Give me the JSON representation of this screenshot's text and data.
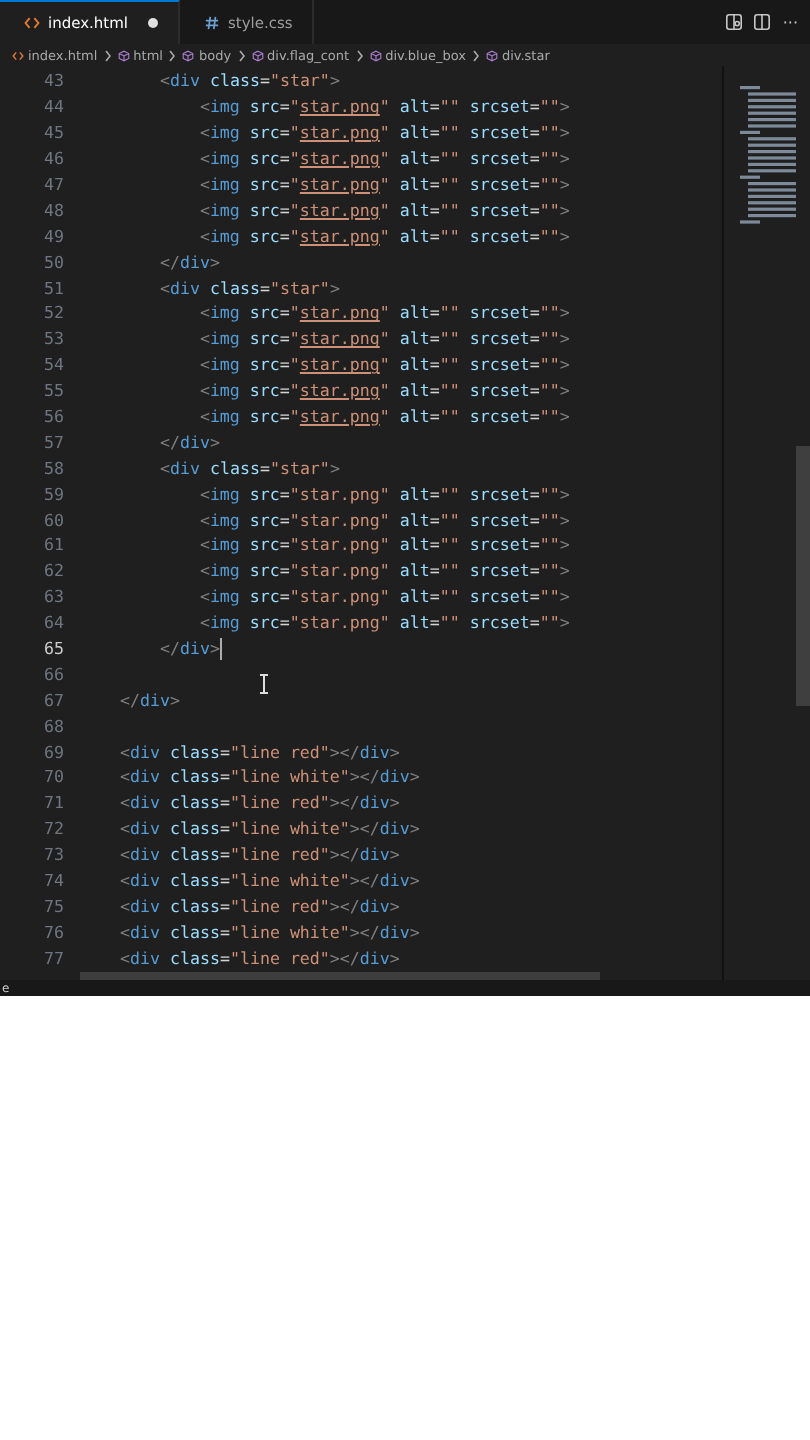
{
  "tabs": [
    {
      "label": "index.html",
      "kind": "html",
      "selected": true,
      "modified": true
    },
    {
      "label": "style.css",
      "kind": "css",
      "selected": false,
      "modified": false
    }
  ],
  "more_actions": "···",
  "breadcrumbs": [
    {
      "label": "index.html",
      "kind": "file"
    },
    {
      "label": "html",
      "kind": "element"
    },
    {
      "label": "body",
      "kind": "element"
    },
    {
      "label": "div.flag_cont",
      "kind": "element"
    },
    {
      "label": "div.blue_box",
      "kind": "element"
    },
    {
      "label": "div.star",
      "kind": "element"
    }
  ],
  "lines": [
    {
      "number": "43",
      "current": false,
      "code": [
        {
          "kind": "punct",
          "text": "        <"
        },
        {
          "kind": "tag",
          "text": "div"
        },
        {
          "kind": "attr",
          "text": " class"
        },
        {
          "kind": "op",
          "text": "="
        },
        {
          "kind": "str",
          "text": "\"star\""
        },
        {
          "kind": "punct",
          "text": ">"
        }
      ]
    },
    {
      "number": "44",
      "current": false,
      "code": [
        {
          "kind": "punct",
          "text": "            <"
        },
        {
          "kind": "tag",
          "text": "img"
        },
        {
          "kind": "attr",
          "text": " src"
        },
        {
          "kind": "op",
          "text": "="
        },
        {
          "kind": "str",
          "text": "\""
        },
        {
          "kind": "link",
          "text": "star.png"
        },
        {
          "kind": "str",
          "text": "\""
        },
        {
          "kind": "attr",
          "text": " alt"
        },
        {
          "kind": "op",
          "text": "="
        },
        {
          "kind": "str",
          "text": "\"\""
        },
        {
          "kind": "attr",
          "text": " srcset"
        },
        {
          "kind": "op",
          "text": "="
        },
        {
          "kind": "str",
          "text": "\"\""
        },
        {
          "kind": "punct",
          "text": ">"
        }
      ]
    },
    {
      "number": "45",
      "current": false,
      "code": [
        {
          "kind": "punct",
          "text": "            <"
        },
        {
          "kind": "tag",
          "text": "img"
        },
        {
          "kind": "attr",
          "text": " src"
        },
        {
          "kind": "op",
          "text": "="
        },
        {
          "kind": "str",
          "text": "\""
        },
        {
          "kind": "link",
          "text": "star.png"
        },
        {
          "kind": "str",
          "text": "\""
        },
        {
          "kind": "attr",
          "text": " alt"
        },
        {
          "kind": "op",
          "text": "="
        },
        {
          "kind": "str",
          "text": "\"\""
        },
        {
          "kind": "attr",
          "text": " srcset"
        },
        {
          "kind": "op",
          "text": "="
        },
        {
          "kind": "str",
          "text": "\"\""
        },
        {
          "kind": "punct",
          "text": ">"
        }
      ]
    },
    {
      "number": "46",
      "current": false,
      "code": [
        {
          "kind": "punct",
          "text": "            <"
        },
        {
          "kind": "tag",
          "text": "img"
        },
        {
          "kind": "attr",
          "text": " src"
        },
        {
          "kind": "op",
          "text": "="
        },
        {
          "kind": "str",
          "text": "\""
        },
        {
          "kind": "link",
          "text": "star.png"
        },
        {
          "kind": "str",
          "text": "\""
        },
        {
          "kind": "attr",
          "text": " alt"
        },
        {
          "kind": "op",
          "text": "="
        },
        {
          "kind": "str",
          "text": "\"\""
        },
        {
          "kind": "attr",
          "text": " srcset"
        },
        {
          "kind": "op",
          "text": "="
        },
        {
          "kind": "str",
          "text": "\"\""
        },
        {
          "kind": "punct",
          "text": ">"
        }
      ]
    },
    {
      "number": "47",
      "current": false,
      "code": [
        {
          "kind": "punct",
          "text": "            <"
        },
        {
          "kind": "tag",
          "text": "img"
        },
        {
          "kind": "attr",
          "text": " src"
        },
        {
          "kind": "op",
          "text": "="
        },
        {
          "kind": "str",
          "text": "\""
        },
        {
          "kind": "link",
          "text": "star.png"
        },
        {
          "kind": "str",
          "text": "\""
        },
        {
          "kind": "attr",
          "text": " alt"
        },
        {
          "kind": "op",
          "text": "="
        },
        {
          "kind": "str",
          "text": "\"\""
        },
        {
          "kind": "attr",
          "text": " srcset"
        },
        {
          "kind": "op",
          "text": "="
        },
        {
          "kind": "str",
          "text": "\"\""
        },
        {
          "kind": "punct",
          "text": ">"
        }
      ]
    },
    {
      "number": "48",
      "current": false,
      "code": [
        {
          "kind": "punct",
          "text": "            <"
        },
        {
          "kind": "tag",
          "text": "img"
        },
        {
          "kind": "attr",
          "text": " src"
        },
        {
          "kind": "op",
          "text": "="
        },
        {
          "kind": "str",
          "text": "\""
        },
        {
          "kind": "link",
          "text": "star.png"
        },
        {
          "kind": "str",
          "text": "\""
        },
        {
          "kind": "attr",
          "text": " alt"
        },
        {
          "kind": "op",
          "text": "="
        },
        {
          "kind": "str",
          "text": "\"\""
        },
        {
          "kind": "attr",
          "text": " srcset"
        },
        {
          "kind": "op",
          "text": "="
        },
        {
          "kind": "str",
          "text": "\"\""
        },
        {
          "kind": "punct",
          "text": ">"
        }
      ]
    },
    {
      "number": "49",
      "current": false,
      "code": [
        {
          "kind": "punct",
          "text": "            <"
        },
        {
          "kind": "tag",
          "text": "img"
        },
        {
          "kind": "attr",
          "text": " src"
        },
        {
          "kind": "op",
          "text": "="
        },
        {
          "kind": "str",
          "text": "\""
        },
        {
          "kind": "link",
          "text": "star.png"
        },
        {
          "kind": "str",
          "text": "\""
        },
        {
          "kind": "attr",
          "text": " alt"
        },
        {
          "kind": "op",
          "text": "="
        },
        {
          "kind": "str",
          "text": "\"\""
        },
        {
          "kind": "attr",
          "text": " srcset"
        },
        {
          "kind": "op",
          "text": "="
        },
        {
          "kind": "str",
          "text": "\"\""
        },
        {
          "kind": "punct",
          "text": ">"
        }
      ]
    },
    {
      "number": "50",
      "current": false,
      "code": [
        {
          "kind": "punct",
          "text": "        </"
        },
        {
          "kind": "tag",
          "text": "div"
        },
        {
          "kind": "punct",
          "text": ">"
        }
      ]
    },
    {
      "number": "51",
      "current": false,
      "code": [
        {
          "kind": "punct",
          "text": "        <"
        },
        {
          "kind": "tag",
          "text": "div"
        },
        {
          "kind": "attr",
          "text": " class"
        },
        {
          "kind": "op",
          "text": "="
        },
        {
          "kind": "str",
          "text": "\"star\""
        },
        {
          "kind": "punct",
          "text": ">"
        }
      ]
    },
    {
      "number": "52",
      "current": false,
      "code": [
        {
          "kind": "punct",
          "text": "            <"
        },
        {
          "kind": "tag",
          "text": "img"
        },
        {
          "kind": "attr",
          "text": " src"
        },
        {
          "kind": "op",
          "text": "="
        },
        {
          "kind": "str",
          "text": "\""
        },
        {
          "kind": "link",
          "text": "star.png"
        },
        {
          "kind": "str",
          "text": "\""
        },
        {
          "kind": "attr",
          "text": " alt"
        },
        {
          "kind": "op",
          "text": "="
        },
        {
          "kind": "str",
          "text": "\"\""
        },
        {
          "kind": "attr",
          "text": " srcset"
        },
        {
          "kind": "op",
          "text": "="
        },
        {
          "kind": "str",
          "text": "\"\""
        },
        {
          "kind": "punct",
          "text": ">"
        }
      ]
    },
    {
      "number": "53",
      "current": false,
      "code": [
        {
          "kind": "punct",
          "text": "            <"
        },
        {
          "kind": "tag",
          "text": "img"
        },
        {
          "kind": "attr",
          "text": " src"
        },
        {
          "kind": "op",
          "text": "="
        },
        {
          "kind": "str",
          "text": "\""
        },
        {
          "kind": "link",
          "text": "star.png"
        },
        {
          "kind": "str",
          "text": "\""
        },
        {
          "kind": "attr",
          "text": " alt"
        },
        {
          "kind": "op",
          "text": "="
        },
        {
          "kind": "str",
          "text": "\"\""
        },
        {
          "kind": "attr",
          "text": " srcset"
        },
        {
          "kind": "op",
          "text": "="
        },
        {
          "kind": "str",
          "text": "\"\""
        },
        {
          "kind": "punct",
          "text": ">"
        }
      ]
    },
    {
      "number": "54",
      "current": false,
      "code": [
        {
          "kind": "punct",
          "text": "            <"
        },
        {
          "kind": "tag",
          "text": "img"
        },
        {
          "kind": "attr",
          "text": " src"
        },
        {
          "kind": "op",
          "text": "="
        },
        {
          "kind": "str",
          "text": "\""
        },
        {
          "kind": "link",
          "text": "star.png"
        },
        {
          "kind": "str",
          "text": "\""
        },
        {
          "kind": "attr",
          "text": " alt"
        },
        {
          "kind": "op",
          "text": "="
        },
        {
          "kind": "str",
          "text": "\"\""
        },
        {
          "kind": "attr",
          "text": " srcset"
        },
        {
          "kind": "op",
          "text": "="
        },
        {
          "kind": "str",
          "text": "\"\""
        },
        {
          "kind": "punct",
          "text": ">"
        }
      ]
    },
    {
      "number": "55",
      "current": false,
      "code": [
        {
          "kind": "punct",
          "text": "            <"
        },
        {
          "kind": "tag",
          "text": "img"
        },
        {
          "kind": "attr",
          "text": " src"
        },
        {
          "kind": "op",
          "text": "="
        },
        {
          "kind": "str",
          "text": "\""
        },
        {
          "kind": "link",
          "text": "star.png"
        },
        {
          "kind": "str",
          "text": "\""
        },
        {
          "kind": "attr",
          "text": " alt"
        },
        {
          "kind": "op",
          "text": "="
        },
        {
          "kind": "str",
          "text": "\"\""
        },
        {
          "kind": "attr",
          "text": " srcset"
        },
        {
          "kind": "op",
          "text": "="
        },
        {
          "kind": "str",
          "text": "\"\""
        },
        {
          "kind": "punct",
          "text": ">"
        }
      ]
    },
    {
      "number": "56",
      "current": false,
      "code": [
        {
          "kind": "punct",
          "text": "            <"
        },
        {
          "kind": "tag",
          "text": "img"
        },
        {
          "kind": "attr",
          "text": " src"
        },
        {
          "kind": "op",
          "text": "="
        },
        {
          "kind": "str",
          "text": "\""
        },
        {
          "kind": "link",
          "text": "star.png"
        },
        {
          "kind": "str",
          "text": "\""
        },
        {
          "kind": "attr",
          "text": " alt"
        },
        {
          "kind": "op",
          "text": "="
        },
        {
          "kind": "str",
          "text": "\"\""
        },
        {
          "kind": "attr",
          "text": " srcset"
        },
        {
          "kind": "op",
          "text": "="
        },
        {
          "kind": "str",
          "text": "\"\""
        },
        {
          "kind": "punct",
          "text": ">"
        }
      ]
    },
    {
      "number": "57",
      "current": false,
      "code": [
        {
          "kind": "punct",
          "text": "        </"
        },
        {
          "kind": "tag",
          "text": "div"
        },
        {
          "kind": "punct",
          "text": ">"
        }
      ]
    },
    {
      "number": "58",
      "current": false,
      "code": [
        {
          "kind": "punct",
          "text": "        <"
        },
        {
          "kind": "tag",
          "text": "div"
        },
        {
          "kind": "attr",
          "text": " class"
        },
        {
          "kind": "op",
          "text": "="
        },
        {
          "kind": "str",
          "text": "\"star\""
        },
        {
          "kind": "punct",
          "text": ">"
        }
      ]
    },
    {
      "number": "59",
      "current": false,
      "code": [
        {
          "kind": "punct",
          "text": "            <"
        },
        {
          "kind": "tag",
          "text": "img"
        },
        {
          "kind": "attr",
          "text": " src"
        },
        {
          "kind": "op",
          "text": "="
        },
        {
          "kind": "str",
          "text": "\"star.png\""
        },
        {
          "kind": "attr",
          "text": " alt"
        },
        {
          "kind": "op",
          "text": "="
        },
        {
          "kind": "str",
          "text": "\"\""
        },
        {
          "kind": "attr",
          "text": " srcset"
        },
        {
          "kind": "op",
          "text": "="
        },
        {
          "kind": "str",
          "text": "\"\""
        },
        {
          "kind": "punct",
          "text": ">"
        }
      ]
    },
    {
      "number": "60",
      "current": false,
      "code": [
        {
          "kind": "punct",
          "text": "            <"
        },
        {
          "kind": "tag",
          "text": "img"
        },
        {
          "kind": "attr",
          "text": " src"
        },
        {
          "kind": "op",
          "text": "="
        },
        {
          "kind": "str",
          "text": "\"star.png\""
        },
        {
          "kind": "attr",
          "text": " alt"
        },
        {
          "kind": "op",
          "text": "="
        },
        {
          "kind": "str",
          "text": "\"\""
        },
        {
          "kind": "attr",
          "text": " srcset"
        },
        {
          "kind": "op",
          "text": "="
        },
        {
          "kind": "str",
          "text": "\"\""
        },
        {
          "kind": "punct",
          "text": ">"
        }
      ]
    },
    {
      "number": "61",
      "current": false,
      "code": [
        {
          "kind": "punct",
          "text": "            <"
        },
        {
          "kind": "tag",
          "text": "img"
        },
        {
          "kind": "attr",
          "text": " src"
        },
        {
          "kind": "op",
          "text": "="
        },
        {
          "kind": "str",
          "text": "\"star.png\""
        },
        {
          "kind": "attr",
          "text": " alt"
        },
        {
          "kind": "op",
          "text": "="
        },
        {
          "kind": "str",
          "text": "\"\""
        },
        {
          "kind": "attr",
          "text": " srcset"
        },
        {
          "kind": "op",
          "text": "="
        },
        {
          "kind": "str",
          "text": "\"\""
        },
        {
          "kind": "punct",
          "text": ">"
        }
      ]
    },
    {
      "number": "62",
      "current": false,
      "code": [
        {
          "kind": "punct",
          "text": "            <"
        },
        {
          "kind": "tag",
          "text": "img"
        },
        {
          "kind": "attr",
          "text": " src"
        },
        {
          "kind": "op",
          "text": "="
        },
        {
          "kind": "str",
          "text": "\"star.png\""
        },
        {
          "kind": "attr",
          "text": " alt"
        },
        {
          "kind": "op",
          "text": "="
        },
        {
          "kind": "str",
          "text": "\"\""
        },
        {
          "kind": "attr",
          "text": " srcset"
        },
        {
          "kind": "op",
          "text": "="
        },
        {
          "kind": "str",
          "text": "\"\""
        },
        {
          "kind": "punct",
          "text": ">"
        }
      ]
    },
    {
      "number": "63",
      "current": false,
      "code": [
        {
          "kind": "punct",
          "text": "            <"
        },
        {
          "kind": "tag",
          "text": "img"
        },
        {
          "kind": "attr",
          "text": " src"
        },
        {
          "kind": "op",
          "text": "="
        },
        {
          "kind": "str",
          "text": "\"star.png\""
        },
        {
          "kind": "attr",
          "text": " alt"
        },
        {
          "kind": "op",
          "text": "="
        },
        {
          "kind": "str",
          "text": "\"\""
        },
        {
          "kind": "attr",
          "text": " srcset"
        },
        {
          "kind": "op",
          "text": "="
        },
        {
          "kind": "str",
          "text": "\"\""
        },
        {
          "kind": "punct",
          "text": ">"
        }
      ]
    },
    {
      "number": "64",
      "current": false,
      "code": [
        {
          "kind": "punct",
          "text": "            <"
        },
        {
          "kind": "tag",
          "text": "img"
        },
        {
          "kind": "attr",
          "text": " src"
        },
        {
          "kind": "op",
          "text": "="
        },
        {
          "kind": "str",
          "text": "\"star.png\""
        },
        {
          "kind": "attr",
          "text": " alt"
        },
        {
          "kind": "op",
          "text": "="
        },
        {
          "kind": "str",
          "text": "\"\""
        },
        {
          "kind": "attr",
          "text": " srcset"
        },
        {
          "kind": "op",
          "text": "="
        },
        {
          "kind": "str",
          "text": "\"\""
        },
        {
          "kind": "punct",
          "text": ">"
        }
      ]
    },
    {
      "number": "65",
      "current": true,
      "code": [
        {
          "kind": "punct",
          "text": "        </"
        },
        {
          "kind": "tag",
          "text": "div"
        },
        {
          "kind": "punct",
          "text": ">"
        }
      ]
    },
    {
      "number": "66",
      "current": false
    },
    {
      "number": "67",
      "current": false,
      "code": [
        {
          "kind": "punct",
          "text": "    </"
        },
        {
          "kind": "tag",
          "text": "div"
        },
        {
          "kind": "punct",
          "text": ">"
        }
      ]
    },
    {
      "number": "68",
      "current": false
    },
    {
      "number": "69",
      "current": false,
      "code": [
        {
          "kind": "punct",
          "text": "    <"
        },
        {
          "kind": "tag",
          "text": "div"
        },
        {
          "kind": "attr",
          "text": " class"
        },
        {
          "kind": "op",
          "text": "="
        },
        {
          "kind": "str",
          "text": "\"line red\""
        },
        {
          "kind": "punct",
          "text": "></"
        },
        {
          "kind": "tag",
          "text": "div"
        },
        {
          "kind": "punct",
          "text": ">"
        }
      ]
    },
    {
      "number": "70",
      "current": false,
      "code": [
        {
          "kind": "punct",
          "text": "    <"
        },
        {
          "kind": "tag",
          "text": "div"
        },
        {
          "kind": "attr",
          "text": " class"
        },
        {
          "kind": "op",
          "text": "="
        },
        {
          "kind": "str",
          "text": "\"line white\""
        },
        {
          "kind": "punct",
          "text": "></"
        },
        {
          "kind": "tag",
          "text": "div"
        },
        {
          "kind": "punct",
          "text": ">"
        }
      ]
    },
    {
      "number": "71",
      "current": false,
      "code": [
        {
          "kind": "punct",
          "text": "    <"
        },
        {
          "kind": "tag",
          "text": "div"
        },
        {
          "kind": "attr",
          "text": " class"
        },
        {
          "kind": "op",
          "text": "="
        },
        {
          "kind": "str",
          "text": "\"line red\""
        },
        {
          "kind": "punct",
          "text": "></"
        },
        {
          "kind": "tag",
          "text": "div"
        },
        {
          "kind": "punct",
          "text": ">"
        }
      ]
    },
    {
      "number": "72",
      "current": false,
      "code": [
        {
          "kind": "punct",
          "text": "    <"
        },
        {
          "kind": "tag",
          "text": "div"
        },
        {
          "kind": "attr",
          "text": " class"
        },
        {
          "kind": "op",
          "text": "="
        },
        {
          "kind": "str",
          "text": "\"line white\""
        },
        {
          "kind": "punct",
          "text": "></"
        },
        {
          "kind": "tag",
          "text": "div"
        },
        {
          "kind": "punct",
          "text": ">"
        }
      ]
    },
    {
      "number": "73",
      "current": false,
      "code": [
        {
          "kind": "punct",
          "text": "    <"
        },
        {
          "kind": "tag",
          "text": "div"
        },
        {
          "kind": "attr",
          "text": " class"
        },
        {
          "kind": "op",
          "text": "="
        },
        {
          "kind": "str",
          "text": "\"line red\""
        },
        {
          "kind": "punct",
          "text": "></"
        },
        {
          "kind": "tag",
          "text": "div"
        },
        {
          "kind": "punct",
          "text": ">"
        }
      ]
    },
    {
      "number": "74",
      "current": false,
      "code": [
        {
          "kind": "punct",
          "text": "    <"
        },
        {
          "kind": "tag",
          "text": "div"
        },
        {
          "kind": "attr",
          "text": " class"
        },
        {
          "kind": "op",
          "text": "="
        },
        {
          "kind": "str",
          "text": "\"line white\""
        },
        {
          "kind": "punct",
          "text": "></"
        },
        {
          "kind": "tag",
          "text": "div"
        },
        {
          "kind": "punct",
          "text": ">"
        }
      ]
    },
    {
      "number": "75",
      "current": false,
      "code": [
        {
          "kind": "punct",
          "text": "    <"
        },
        {
          "kind": "tag",
          "text": "div"
        },
        {
          "kind": "attr",
          "text": " class"
        },
        {
          "kind": "op",
          "text": "="
        },
        {
          "kind": "str",
          "text": "\"line red\""
        },
        {
          "kind": "punct",
          "text": "></"
        },
        {
          "kind": "tag",
          "text": "div"
        },
        {
          "kind": "punct",
          "text": ">"
        }
      ]
    },
    {
      "number": "76",
      "current": false,
      "code": [
        {
          "kind": "punct",
          "text": "    <"
        },
        {
          "kind": "tag",
          "text": "div"
        },
        {
          "kind": "attr",
          "text": " class"
        },
        {
          "kind": "op",
          "text": "="
        },
        {
          "kind": "str",
          "text": "\"line white\""
        },
        {
          "kind": "punct",
          "text": "></"
        },
        {
          "kind": "tag",
          "text": "div"
        },
        {
          "kind": "punct",
          "text": ">"
        }
      ]
    },
    {
      "number": "77",
      "current": false,
      "code": [
        {
          "kind": "punct",
          "text": "    <"
        },
        {
          "kind": "tag",
          "text": "div"
        },
        {
          "kind": "attr",
          "text": " class"
        },
        {
          "kind": "op",
          "text": "="
        },
        {
          "kind": "str",
          "text": "\"line red\""
        },
        {
          "kind": "punct",
          "text": "></"
        },
        {
          "kind": "tag",
          "text": "div"
        },
        {
          "kind": "punct",
          "text": ">"
        }
      ]
    }
  ],
  "status_bar": "e"
}
